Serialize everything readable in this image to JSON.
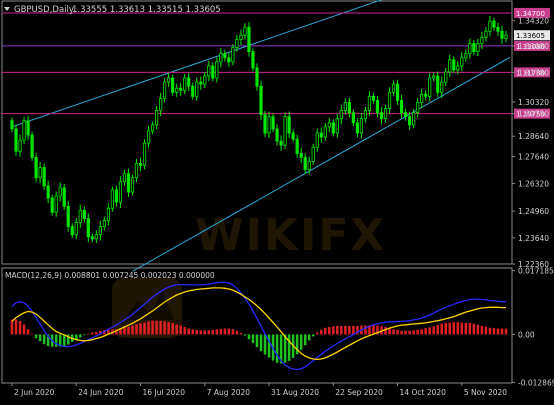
{
  "header": {
    "symbol_timeframe": "GBPUSD,Daily",
    "ohlc": "1.33555 1.33613 1.33515 1.33605"
  },
  "watermark": "WIKIFX",
  "colors": {
    "background": "#000000",
    "frame": "#8a8a8a",
    "grid": "#1e1e1e",
    "bull_candle": "#00e600",
    "bear_candle": "#00e600",
    "channel": "#2aa7d6",
    "level_magenta": "#c8288c",
    "level_purple": "#8c3cc8",
    "level_box": "#c83c8c",
    "price_box": "#e8e8e8",
    "macd_line": "#2828ff",
    "signal_line": "#ffd400",
    "hist_pos": "#e02020",
    "hist_neg": "#20c020",
    "text": "#d0d0d0"
  },
  "chart_data": [
    {
      "type": "candlestick",
      "title": "GBPUSD,Daily",
      "ylim": [
        1.2236,
        1.3455
      ],
      "y_ticks": [
        1.3432,
        1.3308,
        1.3178,
        1.3032,
        1.2975,
        1.2864,
        1.2764,
        1.2632,
        1.2496,
        1.2364,
        1.2236
      ],
      "y_tick_labels": [
        "1.34320",
        "1.33080",
        "1.31780",
        "1.30320",
        "1.29750",
        "1.28640",
        "1.27640",
        "1.26320",
        "1.24960",
        "1.23640",
        "1.22360"
      ],
      "current_price": 1.33605,
      "current_price_label": "1.33605",
      "levels": [
        {
          "label": "1.34700",
          "value": 1.347,
          "color": "level_magenta"
        },
        {
          "label": "1.33080",
          "value": 1.3308,
          "color": "level_purple"
        },
        {
          "label": "1.31780",
          "value": 1.3178,
          "color": "level_magenta"
        },
        {
          "label": "1.29750",
          "value": 1.2975,
          "color": "level_magenta"
        }
      ],
      "channel_lines": [
        {
          "from_index": 0,
          "from_value": 1.291,
          "to_index": 124,
          "to_value": 1.3752
        },
        {
          "from_index": 30,
          "from_value": 1.22,
          "to_index": 124,
          "to_value": 1.3252
        }
      ],
      "x_tick_labels": [
        "2 Jun 2020",
        "24 Jun 2020",
        "16 Jul 2020",
        "7 Aug 2020",
        "31 Aug 2020",
        "22 Sep 2020",
        "14 Oct 2020",
        "5 Nov 2020"
      ],
      "x_tick_index": [
        0,
        16,
        32,
        48,
        64,
        80,
        96,
        112
      ],
      "closes": [
        1.29,
        1.279,
        1.2845,
        1.294,
        1.287,
        1.276,
        1.266,
        1.271,
        1.262,
        1.256,
        1.249,
        1.257,
        1.261,
        1.252,
        1.242,
        1.238,
        1.244,
        1.25,
        1.246,
        1.237,
        1.236,
        1.238,
        1.242,
        1.245,
        1.251,
        1.26,
        1.254,
        1.264,
        1.268,
        1.259,
        1.266,
        1.273,
        1.272,
        1.283,
        1.289,
        1.292,
        1.299,
        1.305,
        1.313,
        1.315,
        1.308,
        1.31,
        1.309,
        1.315,
        1.311,
        1.306,
        1.313,
        1.312,
        1.316,
        1.321,
        1.315,
        1.323,
        1.327,
        1.325,
        1.323,
        1.33,
        1.334,
        1.336,
        1.34,
        1.328,
        1.32,
        1.311,
        1.297,
        1.288,
        1.296,
        1.29,
        1.284,
        1.282,
        1.296,
        1.288,
        1.285,
        1.278,
        1.276,
        1.27,
        1.274,
        1.281,
        1.288,
        1.286,
        1.291,
        1.293,
        1.288,
        1.295,
        1.299,
        1.303,
        1.298,
        1.293,
        1.288,
        1.295,
        1.299,
        1.306,
        1.304,
        1.298,
        1.295,
        1.3,
        1.308,
        1.312,
        1.304,
        1.298,
        1.296,
        1.292,
        1.298,
        1.303,
        1.307,
        1.306,
        1.315,
        1.316,
        1.308,
        1.313,
        1.318,
        1.324,
        1.319,
        1.321,
        1.325,
        1.327,
        1.332,
        1.328,
        1.332,
        1.335,
        1.338,
        1.343,
        1.34,
        1.338,
        1.3345,
        1.3361
      ]
    },
    {
      "type": "macd",
      "title": "MACD(12,26,9) 0.008801 0.007245 0.002023 0.000000",
      "ylim": [
        -0.01304,
        0.01785
      ],
      "y_ticks": [
        0.017185,
        0.0,
        -0.012869
      ],
      "y_tick_labels": [
        "0.017185",
        "0.00",
        "-0.012869"
      ],
      "signal": [
        0.0035,
        0.0045,
        0.0052,
        0.0058,
        0.0062,
        0.006,
        0.0055,
        0.0046,
        0.0036,
        0.0026,
        0.0016,
        0.0008,
        0.0003,
        -0.0001,
        -0.0006,
        -0.0011,
        -0.0014,
        -0.0016,
        -0.0017,
        -0.0016,
        -0.0014,
        -0.0011,
        -0.0008,
        -0.0004,
        0.0001,
        0.0005,
        0.001,
        0.0015,
        0.002,
        0.0025,
        0.003,
        0.0036,
        0.0042,
        0.0049,
        0.0056,
        0.0063,
        0.0071,
        0.0079,
        0.0087,
        0.0094,
        0.01,
        0.0106,
        0.011,
        0.0114,
        0.0117,
        0.0119,
        0.0121,
        0.0122,
        0.0123,
        0.0124,
        0.0125,
        0.0125,
        0.0125,
        0.0124,
        0.0122,
        0.0119,
        0.0114,
        0.0108,
        0.0101,
        0.0094,
        0.0086,
        0.0077,
        0.0067,
        0.0056,
        0.0044,
        0.0032,
        0.002,
        0.0007,
        -0.0006,
        -0.0018,
        -0.003,
        -0.0041,
        -0.0051,
        -0.0058,
        -0.0063,
        -0.0066,
        -0.0067,
        -0.0066,
        -0.0063,
        -0.0058,
        -0.0053,
        -0.0047,
        -0.0041,
        -0.0035,
        -0.0029,
        -0.0023,
        -0.0017,
        -0.0012,
        -0.0007,
        -0.0003,
        0.0001,
        0.0005,
        0.0009,
        0.0013,
        0.0017,
        0.002,
        0.0023,
        0.0025,
        0.0026,
        0.0027,
        0.0028,
        0.0029,
        0.003,
        0.0031,
        0.0033,
        0.0035,
        0.0037,
        0.0039,
        0.0042,
        0.0045,
        0.0048,
        0.0052,
        0.0056,
        0.006,
        0.0063,
        0.0066,
        0.0069,
        0.0071,
        0.0072,
        0.0073,
        0.0073,
        0.0073,
        0.0072,
        0.0072
      ],
      "macd": [
        0.0075,
        0.0085,
        0.0088,
        0.0085,
        0.0076,
        0.0062,
        0.0045,
        0.0028,
        0.001,
        -0.0005,
        -0.0017,
        -0.0025,
        -0.003,
        -0.0032,
        -0.0033,
        -0.0031,
        -0.0028,
        -0.0024,
        -0.0019,
        -0.0014,
        -0.0009,
        -0.0004,
        0.0002,
        0.0008,
        0.0014,
        0.0019,
        0.0025,
        0.0032,
        0.0039,
        0.0046,
        0.0054,
        0.0063,
        0.0072,
        0.0081,
        0.0091,
        0.01,
        0.0108,
        0.0115,
        0.0122,
        0.0127,
        0.0131,
        0.0133,
        0.0134,
        0.0134,
        0.0133,
        0.0133,
        0.0133,
        0.0133,
        0.0134,
        0.0135,
        0.0137,
        0.0139,
        0.014,
        0.014,
        0.0138,
        0.0133,
        0.0124,
        0.0112,
        0.0098,
        0.0081,
        0.0063,
        0.0043,
        0.0022,
        0.0002,
        -0.0018,
        -0.0038,
        -0.0056,
        -0.0071,
        -0.0082,
        -0.0089,
        -0.0093,
        -0.0094,
        -0.0092,
        -0.0087,
        -0.0079,
        -0.0071,
        -0.0062,
        -0.0053,
        -0.0045,
        -0.0038,
        -0.0031,
        -0.0024,
        -0.0018,
        -0.0012,
        -0.0006,
        0.0,
        0.0006,
        0.0012,
        0.0017,
        0.0022,
        0.0026,
        0.0029,
        0.0031,
        0.0033,
        0.0034,
        0.0034,
        0.0035,
        0.0035,
        0.0036,
        0.0037,
        0.0039,
        0.0041,
        0.0044,
        0.0048,
        0.0052,
        0.0057,
        0.0063,
        0.0068,
        0.0073,
        0.0077,
        0.0081,
        0.0085,
        0.0088,
        0.0091,
        0.0094,
        0.0095,
        0.0095,
        0.0094,
        0.0093,
        0.0091,
        0.009,
        0.0089,
        0.0088,
        0.0088
      ],
      "histogram": [
        0.004,
        0.004,
        0.0036,
        0.0027,
        0.0014,
        0.0002,
        -0.001,
        -0.0018,
        -0.0026,
        -0.0031,
        -0.0033,
        -0.0033,
        -0.0033,
        -0.0031,
        -0.0027,
        -0.002,
        -0.0014,
        -0.0008,
        -0.0002,
        0.0002,
        0.0005,
        0.0007,
        0.001,
        0.0012,
        0.0013,
        0.0014,
        0.0015,
        0.0017,
        0.0019,
        0.0021,
        0.0024,
        0.0027,
        0.003,
        0.0032,
        0.0035,
        0.0037,
        0.0037,
        0.0036,
        0.0035,
        0.0033,
        0.0031,
        0.0027,
        0.0024,
        0.002,
        0.0016,
        0.0014,
        0.0012,
        0.0011,
        0.0011,
        0.0011,
        0.0012,
        0.0014,
        0.0015,
        0.0016,
        0.0016,
        0.0014,
        0.001,
        0.0004,
        -0.0003,
        -0.0013,
        -0.0023,
        -0.0034,
        -0.0045,
        -0.0054,
        -0.0062,
        -0.007,
        -0.0076,
        -0.0078,
        -0.0076,
        -0.0071,
        -0.0063,
        -0.0053,
        -0.0041,
        -0.0029,
        -0.0016,
        -0.0005,
        0.0005,
        0.0013,
        0.0018,
        0.002,
        0.0022,
        0.0023,
        0.0023,
        0.0023,
        0.0023,
        0.0023,
        0.0023,
        0.0024,
        0.0024,
        0.0025,
        0.0025,
        0.0024,
        0.0022,
        0.002,
        0.0017,
        0.0014,
        0.0012,
        0.001,
        0.001,
        0.001,
        0.0011,
        0.0012,
        0.0014,
        0.0017,
        0.0019,
        0.0022,
        0.0026,
        0.0029,
        0.0031,
        0.0032,
        0.0033,
        0.0033,
        0.0032,
        0.0031,
        0.0031,
        0.0029,
        0.0026,
        0.0023,
        0.0021,
        0.0018,
        0.0017,
        0.0016,
        0.0016,
        0.0016
      ]
    }
  ]
}
